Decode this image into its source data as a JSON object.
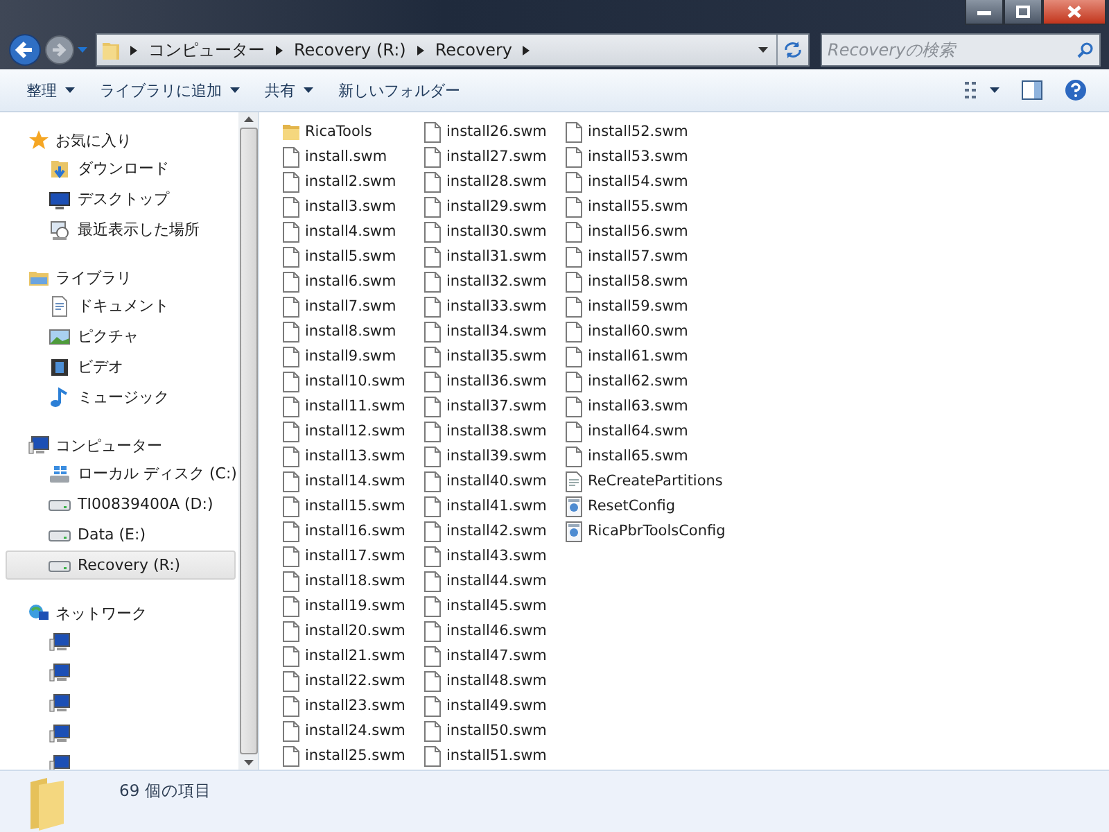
{
  "address": {
    "crumbs": [
      "コンピューター",
      "Recovery (R:)",
      "Recovery"
    ]
  },
  "search": {
    "placeholder": "Recoveryの検索"
  },
  "toolbar": {
    "items": [
      {
        "label": "整理",
        "dropdown": true
      },
      {
        "label": "ライブラリに追加",
        "dropdown": true
      },
      {
        "label": "共有",
        "dropdown": true
      },
      {
        "label": "新しいフォルダー",
        "dropdown": false
      }
    ]
  },
  "sidebar": {
    "groups": [
      {
        "label": "お気に入り",
        "kind": "star",
        "children": [
          {
            "label": "ダウンロード",
            "kind": "download",
            "selected": false
          },
          {
            "label": "デスクトップ",
            "kind": "desktop",
            "selected": false
          },
          {
            "label": "最近表示した場所",
            "kind": "recent",
            "selected": false
          }
        ]
      },
      {
        "label": "ライブラリ",
        "kind": "library",
        "children": [
          {
            "label": "ドキュメント",
            "kind": "document",
            "selected": false
          },
          {
            "label": "ピクチャ",
            "kind": "picture",
            "selected": false
          },
          {
            "label": "ビデオ",
            "kind": "video",
            "selected": false
          },
          {
            "label": "ミュージック",
            "kind": "music",
            "selected": false
          }
        ]
      },
      {
        "label": "コンピューター",
        "kind": "computer",
        "children": [
          {
            "label": "ローカル ディスク (C:)",
            "kind": "sysdrive",
            "selected": false
          },
          {
            "label": "TI00839400A (D:)",
            "kind": "drive",
            "selected": false
          },
          {
            "label": "Data (E:)",
            "kind": "drive",
            "selected": false
          },
          {
            "label": "Recovery (R:)",
            "kind": "drive",
            "selected": true
          }
        ]
      },
      {
        "label": "ネットワーク",
        "kind": "network",
        "children": [
          {
            "kind": "computer",
            "selected": false
          },
          {
            "kind": "computer",
            "selected": false
          },
          {
            "kind": "computer",
            "selected": false
          },
          {
            "kind": "computer",
            "selected": false
          },
          {
            "kind": "computer",
            "selected": false
          }
        ]
      }
    ]
  },
  "files": [
    {
      "name": "RicaTools",
      "kind": "folder"
    },
    {
      "name": "install.swm",
      "kind": "file"
    },
    {
      "name": "install2.swm",
      "kind": "file"
    },
    {
      "name": "install3.swm",
      "kind": "file"
    },
    {
      "name": "install4.swm",
      "kind": "file"
    },
    {
      "name": "install5.swm",
      "kind": "file"
    },
    {
      "name": "install6.swm",
      "kind": "file"
    },
    {
      "name": "install7.swm",
      "kind": "file"
    },
    {
      "name": "install8.swm",
      "kind": "file"
    },
    {
      "name": "install9.swm",
      "kind": "file"
    },
    {
      "name": "install10.swm",
      "kind": "file"
    },
    {
      "name": "install11.swm",
      "kind": "file"
    },
    {
      "name": "install12.swm",
      "kind": "file"
    },
    {
      "name": "install13.swm",
      "kind": "file"
    },
    {
      "name": "install14.swm",
      "kind": "file"
    },
    {
      "name": "install15.swm",
      "kind": "file"
    },
    {
      "name": "install16.swm",
      "kind": "file"
    },
    {
      "name": "install17.swm",
      "kind": "file"
    },
    {
      "name": "install18.swm",
      "kind": "file"
    },
    {
      "name": "install19.swm",
      "kind": "file"
    },
    {
      "name": "install20.swm",
      "kind": "file"
    },
    {
      "name": "install21.swm",
      "kind": "file"
    },
    {
      "name": "install22.swm",
      "kind": "file"
    },
    {
      "name": "install23.swm",
      "kind": "file"
    },
    {
      "name": "install24.swm",
      "kind": "file"
    },
    {
      "name": "install25.swm",
      "kind": "file"
    },
    {
      "name": "install26.swm",
      "kind": "file"
    },
    {
      "name": "install27.swm",
      "kind": "file"
    },
    {
      "name": "install28.swm",
      "kind": "file"
    },
    {
      "name": "install29.swm",
      "kind": "file"
    },
    {
      "name": "install30.swm",
      "kind": "file"
    },
    {
      "name": "install31.swm",
      "kind": "file"
    },
    {
      "name": "install32.swm",
      "kind": "file"
    },
    {
      "name": "install33.swm",
      "kind": "file"
    },
    {
      "name": "install34.swm",
      "kind": "file"
    },
    {
      "name": "install35.swm",
      "kind": "file"
    },
    {
      "name": "install36.swm",
      "kind": "file"
    },
    {
      "name": "install37.swm",
      "kind": "file"
    },
    {
      "name": "install38.swm",
      "kind": "file"
    },
    {
      "name": "install39.swm",
      "kind": "file"
    },
    {
      "name": "install40.swm",
      "kind": "file"
    },
    {
      "name": "install41.swm",
      "kind": "file"
    },
    {
      "name": "install42.swm",
      "kind": "file"
    },
    {
      "name": "install43.swm",
      "kind": "file"
    },
    {
      "name": "install44.swm",
      "kind": "file"
    },
    {
      "name": "install45.swm",
      "kind": "file"
    },
    {
      "name": "install46.swm",
      "kind": "file"
    },
    {
      "name": "install47.swm",
      "kind": "file"
    },
    {
      "name": "install48.swm",
      "kind": "file"
    },
    {
      "name": "install49.swm",
      "kind": "file"
    },
    {
      "name": "install50.swm",
      "kind": "file"
    },
    {
      "name": "install51.swm",
      "kind": "file"
    },
    {
      "name": "install52.swm",
      "kind": "file"
    },
    {
      "name": "install53.swm",
      "kind": "file"
    },
    {
      "name": "install54.swm",
      "kind": "file"
    },
    {
      "name": "install55.swm",
      "kind": "file"
    },
    {
      "name": "install56.swm",
      "kind": "file"
    },
    {
      "name": "install57.swm",
      "kind": "file"
    },
    {
      "name": "install58.swm",
      "kind": "file"
    },
    {
      "name": "install59.swm",
      "kind": "file"
    },
    {
      "name": "install60.swm",
      "kind": "file"
    },
    {
      "name": "install61.swm",
      "kind": "file"
    },
    {
      "name": "install62.swm",
      "kind": "file"
    },
    {
      "name": "install63.swm",
      "kind": "file"
    },
    {
      "name": "install64.swm",
      "kind": "file"
    },
    {
      "name": "install65.swm",
      "kind": "file"
    },
    {
      "name": "ReCreatePartitions",
      "kind": "script"
    },
    {
      "name": "ResetConfig",
      "kind": "config"
    },
    {
      "name": "RicaPbrToolsConfig",
      "kind": "config"
    }
  ],
  "status_bar": {
    "text": "69 個の項目"
  }
}
